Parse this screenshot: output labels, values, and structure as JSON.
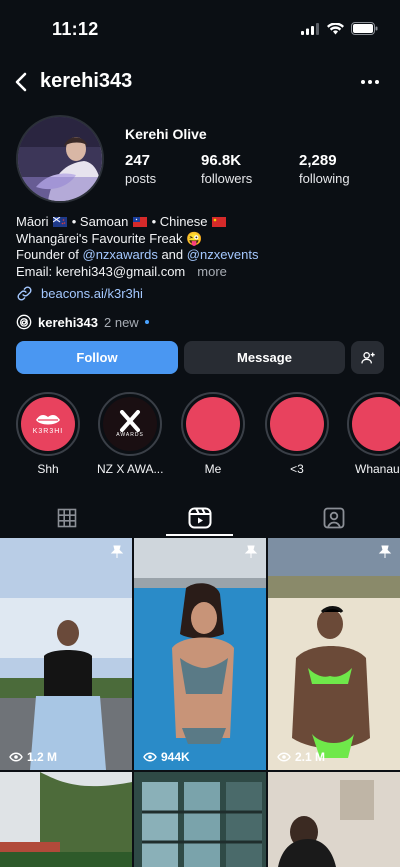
{
  "status_bar": {
    "time": "11:12"
  },
  "header": {
    "username": "kerehi343"
  },
  "profile": {
    "display_name": "Kerehi Olive",
    "stats": [
      {
        "value": "247",
        "label": "posts"
      },
      {
        "value": "96.8K",
        "label": "followers"
      },
      {
        "value": "2,289",
        "label": "following"
      }
    ],
    "bio": {
      "line1": {
        "a": "Māori",
        "b": "• Samoan",
        "c": "• Chinese"
      },
      "line2": "Whangārei's Favourite Freak 😜",
      "line3": {
        "prefix": "Founder of ",
        "mention1": "@nzxawards",
        "mid": " and ",
        "mention2": "@nzxevents"
      },
      "line4": {
        "email": "Email: kerehi343@gmail.com",
        "more": "more"
      }
    },
    "link": "beacons.ai/k3r3hi",
    "threads": {
      "handle": "kerehi343",
      "new_label": "2 new"
    }
  },
  "actions": {
    "follow": "Follow",
    "message": "Message"
  },
  "highlights": [
    {
      "label": "Shh",
      "badge": "K3R3HI"
    },
    {
      "label": "NZ X AWA...",
      "badge": "AWARDS"
    },
    {
      "label": "Me"
    },
    {
      "label": "<3"
    },
    {
      "label": "Whanau"
    }
  ],
  "tabs": [
    "grid",
    "reels",
    "tagged"
  ],
  "grid": [
    {
      "views": "1.2 M",
      "pinned": true
    },
    {
      "views": "944K",
      "pinned": true
    },
    {
      "views": "2.1 M",
      "pinned": true
    },
    {
      "views": ""
    },
    {
      "views": ""
    },
    {
      "views": ""
    }
  ],
  "colors": {
    "accent": "#4a97f2",
    "highlight": "#e8425e",
    "link": "#a4c8ff",
    "background": "#0b0f14"
  }
}
